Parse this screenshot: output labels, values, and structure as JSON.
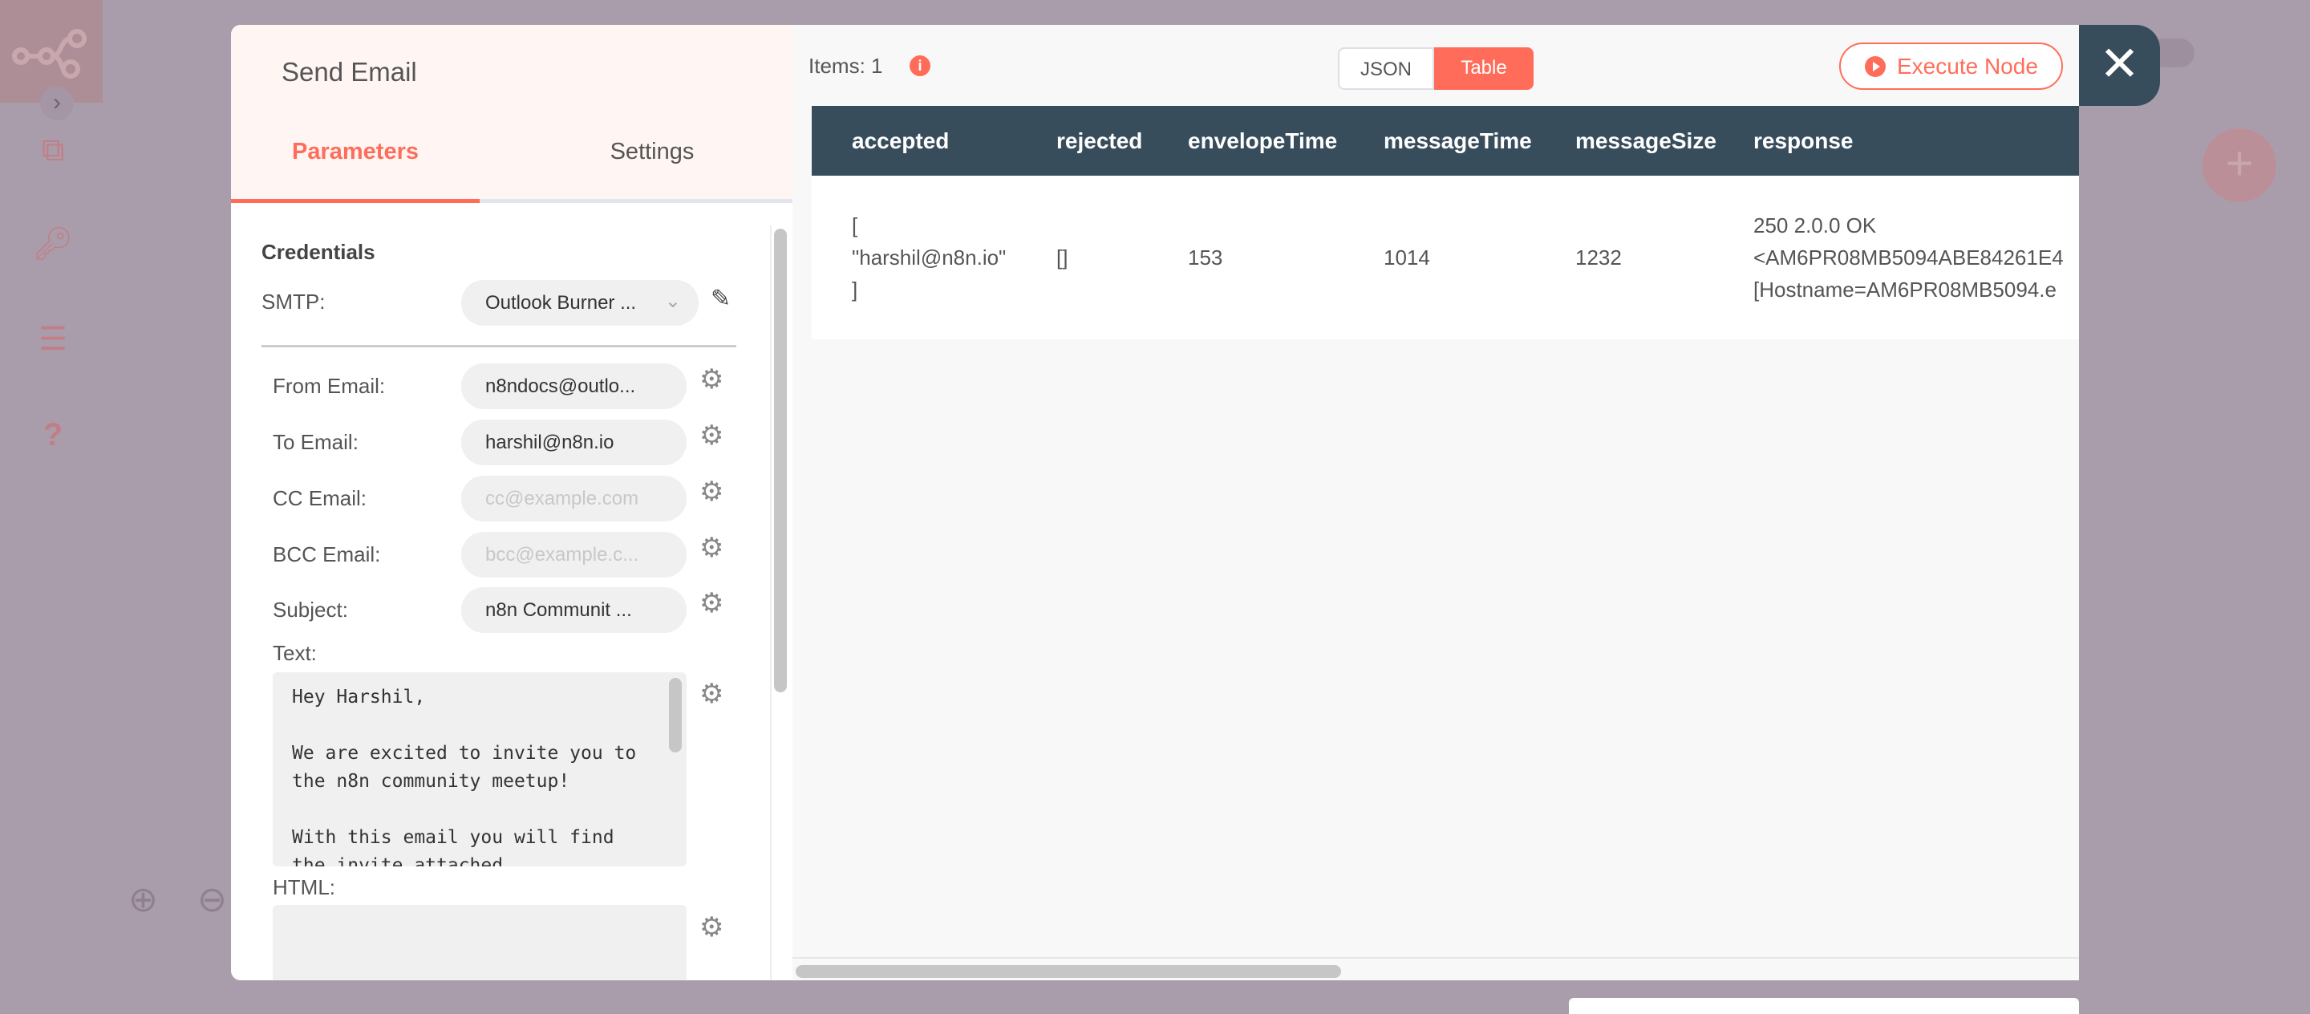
{
  "sidebar": {
    "icons": [
      "n8n-logo-icon",
      "chevron-right-icon",
      "workflow-icon",
      "key-icon",
      "executions-list-icon",
      "help-icon"
    ]
  },
  "canvas": {
    "zoom_in": "zoom-in-icon",
    "zoom_out": "zoom-out-icon"
  },
  "node": {
    "title": "Send Email",
    "tabs": [
      {
        "label": "Parameters",
        "active": true
      },
      {
        "label": "Settings",
        "active": false
      }
    ],
    "credentials": {
      "heading": "Credentials",
      "smtp_label": "SMTP:",
      "smtp_value": "Outlook Burner ..."
    },
    "fields": [
      {
        "label": "From Email:",
        "value": "n8ndocs@outlo...",
        "placeholder": ""
      },
      {
        "label": "To Email:",
        "value": "harshil@n8n.io",
        "placeholder": ""
      },
      {
        "label": "CC Email:",
        "value": "",
        "placeholder": "cc@example.com"
      },
      {
        "label": "BCC Email:",
        "value": "",
        "placeholder": "bcc@example.c..."
      },
      {
        "label": "Subject:",
        "value": "n8n Communit ...",
        "placeholder": ""
      }
    ],
    "text_label": "Text:",
    "text_value": "Hey Harshil,\n\nWe are excited to invite you to the n8n community meetup!\n\nWith this email you will find the invite attached.",
    "html_label": "HTML:"
  },
  "output": {
    "items_label": "Items: 1",
    "view_options": [
      {
        "label": "JSON",
        "active": false
      },
      {
        "label": "Table",
        "active": true
      }
    ],
    "execute_label": "Execute Node",
    "columns": [
      "accepted",
      "rejected",
      "envelopeTime",
      "messageTime",
      "messageSize",
      "response"
    ],
    "rows": [
      [
        "[\n\"harshil@n8n.io\"\n]",
        "[]",
        "153",
        "1014",
        "1232",
        "250 2.0.0 OK\n<AM6PR08MB5094ABE84261E4\n[Hostname=AM6PR08MB5094.e"
      ]
    ]
  },
  "colors": {
    "accent": "#ff6d5a",
    "header": "#384d5c",
    "overlay": "#aa9dab"
  }
}
